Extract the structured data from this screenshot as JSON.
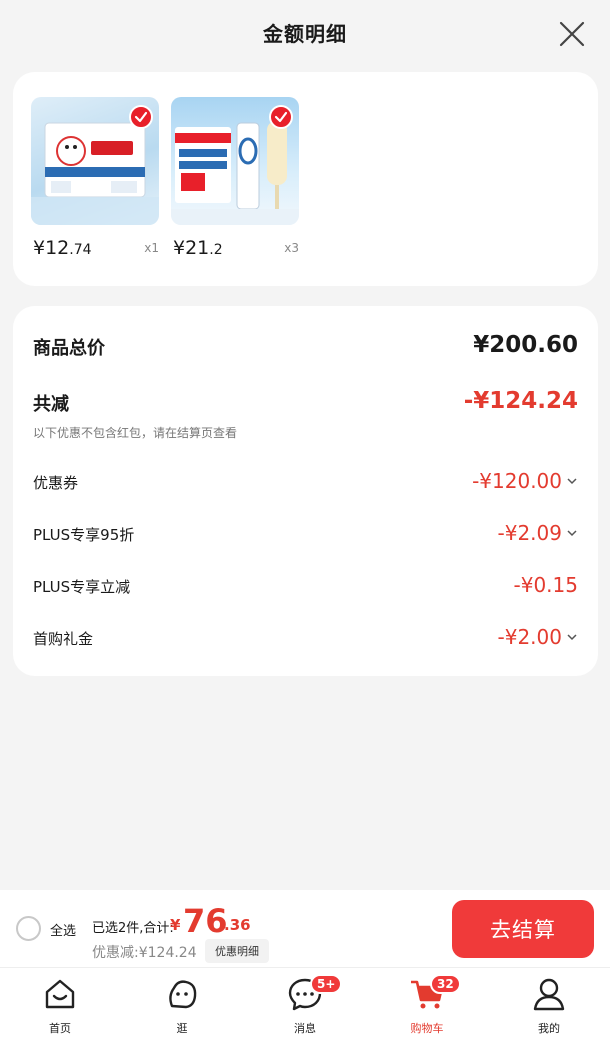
{
  "header": {
    "title": "金额明细"
  },
  "products": [
    {
      "price_int": "¥12",
      "price_dec": ".74",
      "qty": "x1",
      "thumb_title": "大白兔",
      "thumb_subtitle": "奶糖"
    },
    {
      "price_int": "¥21",
      "price_dec": ".2",
      "qty": "x3",
      "thumb_title": "仲夏特卖季",
      "thumb_subtitle": "0蔗糖"
    }
  ],
  "summary": {
    "total_label": "商品总价",
    "total_value": "¥200.60",
    "reduce_label": "共减",
    "reduce_value": "-¥124.24",
    "note": "以下优惠不包含红包，请在结算页查看",
    "items": [
      {
        "label": "优惠券",
        "value": "-¥120.00",
        "has_chevron": true
      },
      {
        "label": "PLUS专享95折",
        "value": "-¥2.09",
        "has_chevron": true
      },
      {
        "label": "PLUS专享立减",
        "value": "-¥0.15",
        "has_chevron": false
      },
      {
        "label": "首购礼金",
        "value": "-¥2.00",
        "has_chevron": true
      }
    ]
  },
  "checkout": {
    "select_all": "全选",
    "selected_text": "已选2件,合计:",
    "total_symbol": "¥",
    "total_int": "76",
    "total_dec": ".36",
    "discount_text": "优惠减:¥124.24",
    "detail_button": "优惠明细",
    "checkout_button": "去结算"
  },
  "tabbar": {
    "items": [
      {
        "label": "首页",
        "icon": "home-icon"
      },
      {
        "label": "逛",
        "icon": "browse-icon"
      },
      {
        "label": "消息",
        "icon": "message-icon",
        "badge": "5+"
      },
      {
        "label": "购物车",
        "icon": "cart-icon",
        "badge": "32",
        "active": true
      },
      {
        "label": "我的",
        "icon": "profile-icon"
      }
    ]
  },
  "colors": {
    "accent": "#e33b2f",
    "button": "#f03a3a",
    "background": "#f4f4f4"
  }
}
